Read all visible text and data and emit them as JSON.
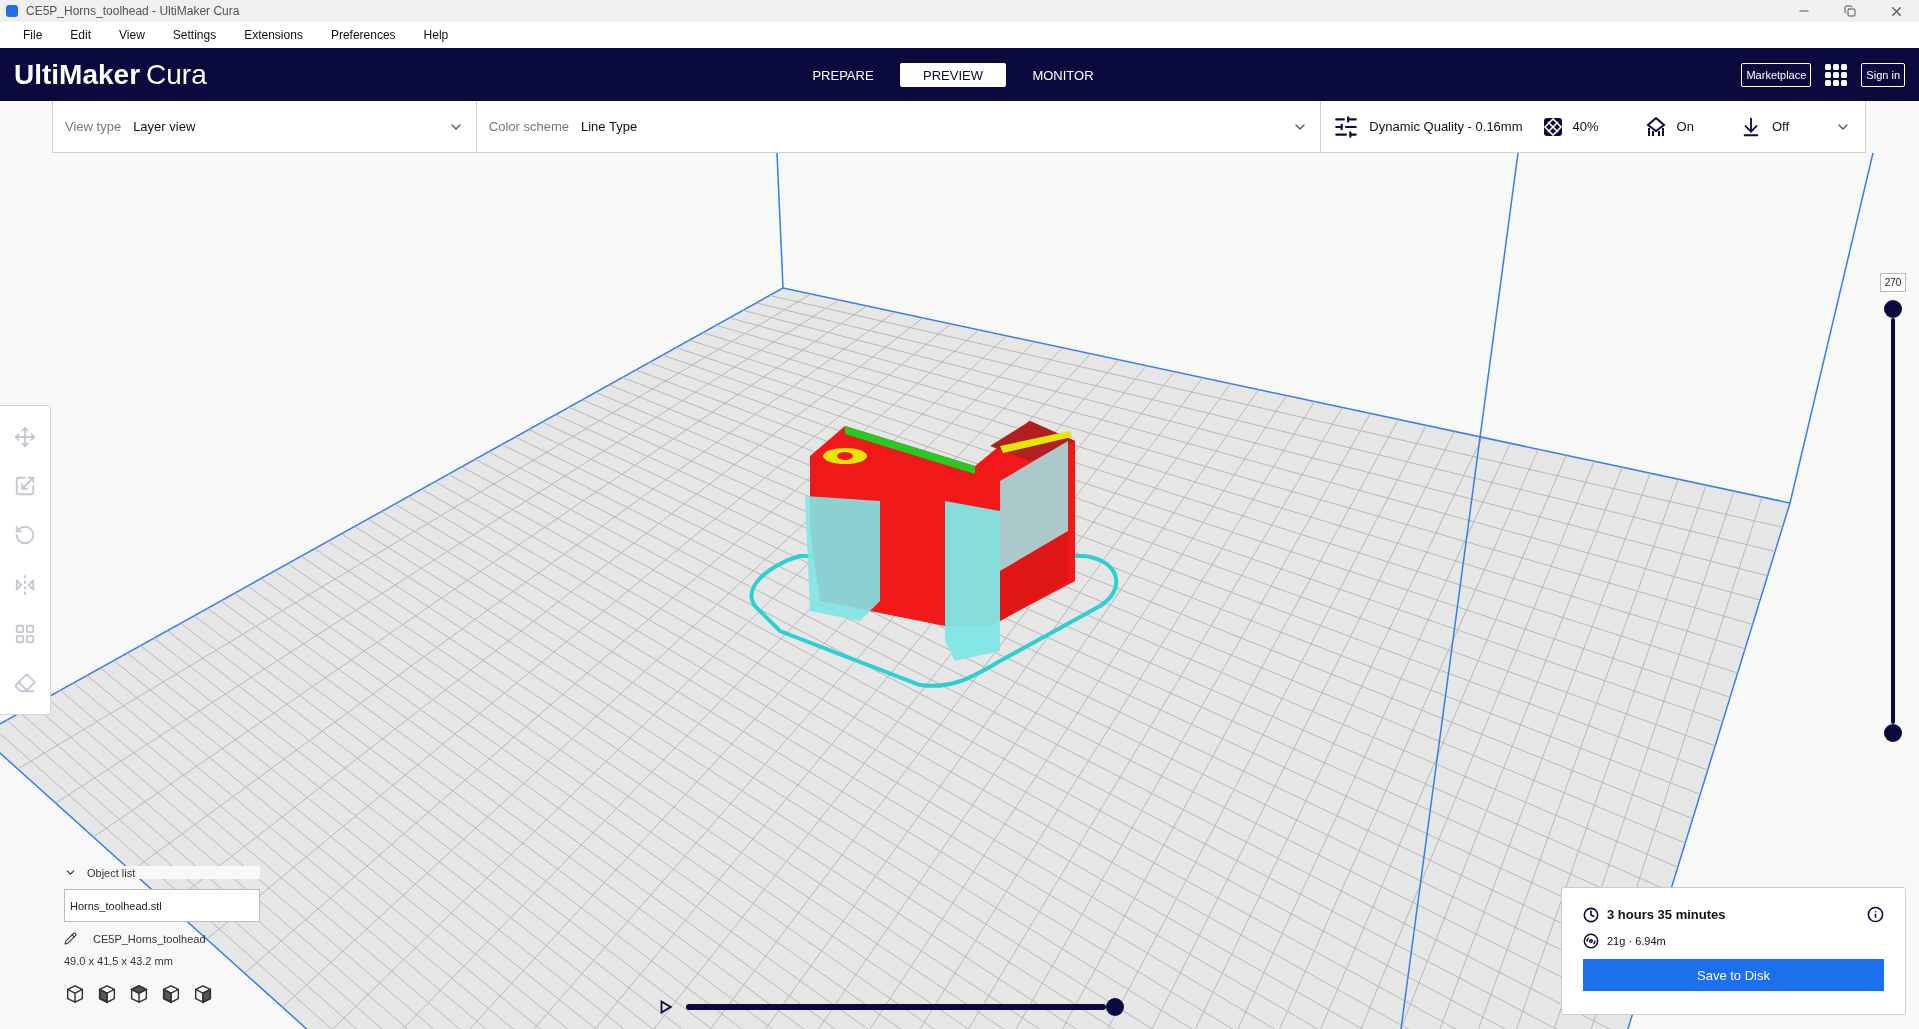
{
  "window": {
    "title": "CE5P_Horns_toolhead - UltiMaker Cura"
  },
  "menu": [
    "File",
    "Edit",
    "View",
    "Settings",
    "Extensions",
    "Preferences",
    "Help"
  ],
  "header": {
    "logo_bold": "UltiMaker",
    "logo_light": "Cura",
    "marketplace": "Marketplace",
    "sign_in": "Sign in",
    "tabs": [
      {
        "label": "PREPARE",
        "selected": false
      },
      {
        "label": "PREVIEW",
        "selected": true
      },
      {
        "label": "MONITOR",
        "selected": false
      }
    ]
  },
  "view_settings": {
    "view_type_label": "View type",
    "view_type": "Layer view",
    "color_scheme_label": "Color scheme",
    "color_scheme": "Line Type",
    "profile": "Dynamic Quality - 0.16mm",
    "infill": "40%",
    "support": "On",
    "adhesion": "Off"
  },
  "tools": [
    {
      "kind": "move",
      "disabled": true
    },
    {
      "kind": "scale",
      "disabled": true
    },
    {
      "kind": "rotate",
      "disabled": true
    },
    {
      "kind": "mirror",
      "disabled": true
    },
    {
      "kind": "per-model",
      "disabled": true
    },
    {
      "kind": "support-blocker",
      "disabled": true
    }
  ],
  "object_list": {
    "title": "Object list",
    "expanded": true,
    "file": "Horns_toolhead.stl",
    "object_name": "CE5P_Horns_toolhead",
    "dimensions": "49.0 x 41.5 x 43.2 mm"
  },
  "layer_slider": {
    "value": "270",
    "level": 1
  },
  "path_slider": {
    "level": 1
  },
  "print_info": {
    "time": "3 hours 35 minutes",
    "material": "21g · 6.94m",
    "button": "Save to Disk"
  }
}
